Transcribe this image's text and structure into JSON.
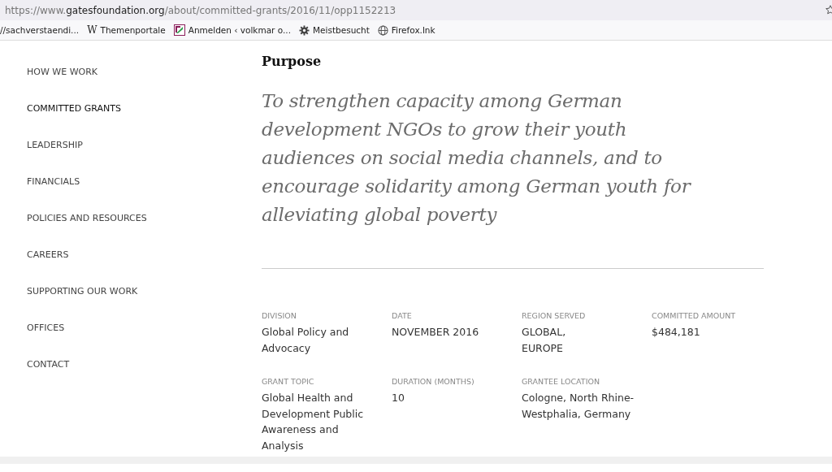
{
  "address_bar": {
    "url_prefix": "https://www.",
    "url_domain": "gatesfoundation.org",
    "url_path": "/about/committed-grants/2016/11/opp1152213"
  },
  "bookmarks": [
    {
      "kind": "plain",
      "label": "//sachverstaendi..."
    },
    {
      "kind": "glyph",
      "glyph": "W",
      "label": "Themenportale"
    },
    {
      "kind": "logo",
      "label": "Anmelden ‹ volkmar o..."
    },
    {
      "kind": "gear",
      "label": "Meistbesucht"
    },
    {
      "kind": "globe",
      "label": "Firefox.lnk"
    }
  ],
  "sidebar": {
    "items": [
      {
        "label": "HOW WE WORK",
        "selected": false
      },
      {
        "label": "COMMITTED GRANTS",
        "selected": true
      },
      {
        "label": "LEADERSHIP",
        "selected": false
      },
      {
        "label": "FINANCIALS",
        "selected": false
      },
      {
        "label": "POLICIES AND RESOURCES",
        "selected": false
      },
      {
        "label": "CAREERS",
        "selected": false
      },
      {
        "label": "SUPPORTING OUR WORK",
        "selected": false
      },
      {
        "label": "OFFICES",
        "selected": false
      },
      {
        "label": "CONTACT",
        "selected": false
      }
    ]
  },
  "purpose": {
    "heading": "Purpose",
    "text": "To strengthen capacity among German development NGOs to grow their youth audiences on social media channels, and to encourage solidarity among German youth for alleviating global poverty"
  },
  "details": [
    {
      "label": "DIVISION",
      "value": "Global Policy and Advocacy"
    },
    {
      "label": "DATE",
      "value": "NOVEMBER 2016"
    },
    {
      "label": "REGION SERVED",
      "value": "GLOBAL,\nEUROPE"
    },
    {
      "label": "COMMITTED AMOUNT",
      "value": "$484,181"
    },
    {
      "label": "GRANT TOPIC",
      "value": "Global Health and Development Public Awareness and Analysis"
    },
    {
      "label": "DURATION (MONTHS)",
      "value": "10"
    },
    {
      "label": "GRANTEE LOCATION",
      "value": "Cologne, North Rhine-Westphalia, Germany"
    }
  ]
}
